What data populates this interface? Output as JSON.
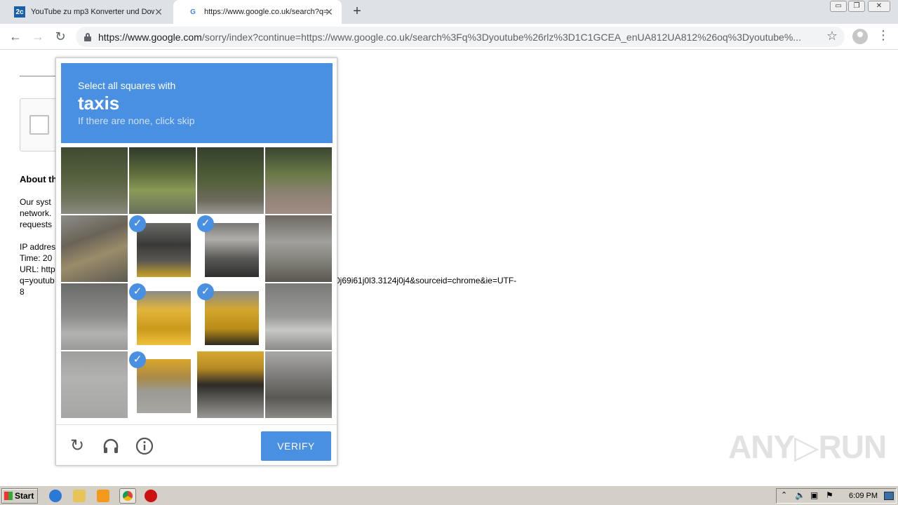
{
  "browser": {
    "tabs": [
      {
        "favicon": "2c",
        "title": "YouTube zu mp3 Konverter und Download"
      },
      {
        "favicon": "G",
        "title": "https://www.google.co.uk/search?q=youtube"
      }
    ],
    "new_tab": "+",
    "close_glyph": "✕",
    "window_controls": [
      "▭",
      "❐",
      "✕"
    ],
    "url_host": "https://www.google.com",
    "url_rest": "/sorry/index?continue=https://www.google.co.uk/search%3Fq%3Dyoutube%26rlz%3D1C1GCEA_enUA812UA812%26oq%3Dyoutube%..."
  },
  "page": {
    "about_heading": "About th",
    "body_lines": [
      "Our syst",
      "network.",
      "requests"
    ],
    "ip_line": "IP addres",
    "time_line": "Time: 20",
    "url_line": "URL: http",
    "q_line": "q=youtub",
    "url_tail": "0j69i61j0l3.3124j0j4&sourceid=chrome&ie=UTF-",
    "url_tail2": "8"
  },
  "captcha": {
    "instruction": "Select all squares with",
    "target": "taxis",
    "hint": "If there are none, click skip",
    "verify_label": "VERIFY",
    "check_glyph": "✓",
    "tiles_selected": [
      5,
      6,
      9,
      10,
      13
    ]
  },
  "watermark": "ANY▷RUN",
  "taskbar": {
    "start_label": "Start",
    "clock": "6:09 PM"
  },
  "colors": {
    "captcha_blue": "#4a90e2",
    "taskbar": "#d4d0c8"
  }
}
